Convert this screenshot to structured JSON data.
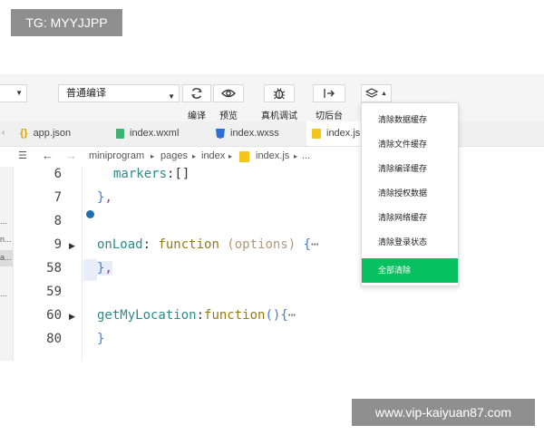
{
  "watermarks": {
    "top_left": "TG: MYYJJPP",
    "bottom_right": "www.vip-kaiyuan87.com"
  },
  "toolbar": {
    "mode_select": {
      "value": "普通编译"
    },
    "compile_label": "编译",
    "preview_label": "预览",
    "debug_label": "真机调试",
    "background_label": "切后台",
    "icons": [
      "refresh-icon",
      "eye-icon",
      "bug-icon",
      "switch-icon",
      "layers-icon"
    ]
  },
  "tabs": [
    {
      "label": "app.json",
      "icon": "braces-icon"
    },
    {
      "label": "index.wxml",
      "icon": "wxml-file-icon"
    },
    {
      "label": "index.wxss",
      "icon": "css3-icon"
    },
    {
      "label": "index.js",
      "icon": "js-file-icon",
      "active": true
    }
  ],
  "breadcrumb": {
    "items": [
      "miniprogram",
      "pages",
      "index",
      "index.js",
      "..."
    ]
  },
  "sidebar": {
    "fragments": [
      "...",
      "n...",
      "a...",
      "..."
    ]
  },
  "editor": {
    "lines": [
      {
        "number": "6",
        "code": "markers:[]"
      },
      {
        "number": "7",
        "code": "},"
      },
      {
        "number": "8",
        "code": ""
      },
      {
        "number": "9",
        "code": "onLoad: function (options) {⋯"
      },
      {
        "number": "58",
        "code": "},"
      },
      {
        "number": "59",
        "code": ""
      },
      {
        "number": "60",
        "code": "getMyLocation:function(){⋯"
      },
      {
        "number": "80",
        "code": "}"
      }
    ],
    "tokens": {
      "markers": "markers",
      "markers_rest": ":[]",
      "brace_close": "}",
      "comma": ",",
      "onload_name": "onLoad",
      "colon_sp": ": ",
      "function_kw": "function",
      "options_arg": " (options) ",
      "open_brace": "{",
      "ellipsis": "⋯",
      "getloc_name": "getMyLocation",
      "colon": ":",
      "parens": "()"
    }
  },
  "dropdown": {
    "items": [
      "清除数据缓存",
      "清除文件缓存",
      "清除编译缓存",
      "清除授权数据",
      "清除网络缓存",
      "清除登录状态",
      "全部清除"
    ],
    "primary_color": "#07c160"
  }
}
